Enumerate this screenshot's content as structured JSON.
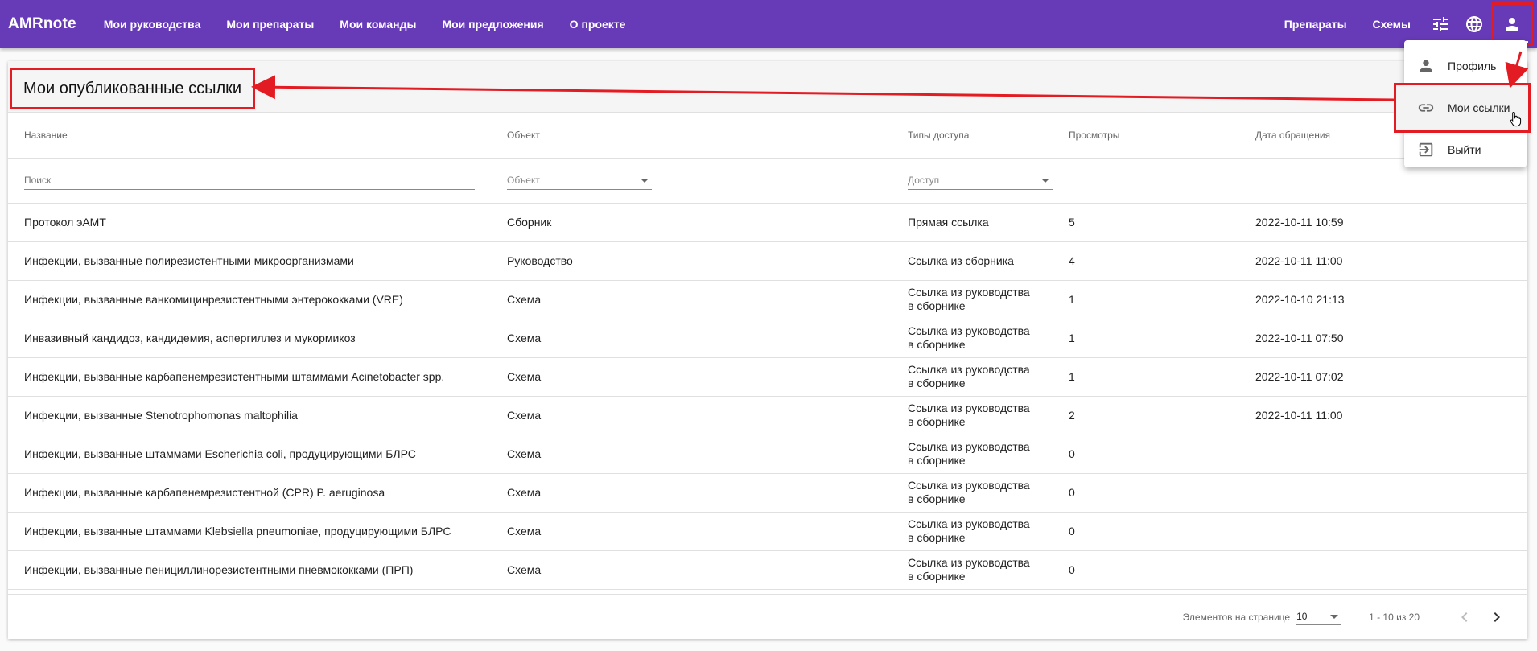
{
  "header": {
    "brand": "AMRnote",
    "nav": [
      {
        "label": "Мои руководства"
      },
      {
        "label": "Мои препараты"
      },
      {
        "label": "Мои команды"
      },
      {
        "label": "Мои предложения"
      },
      {
        "label": "О проекте"
      }
    ],
    "right_links": [
      {
        "label": "Препараты"
      },
      {
        "label": "Схемы"
      }
    ],
    "icons": [
      "tune-icon",
      "globe-icon",
      "user-icon"
    ]
  },
  "page": {
    "title": "Мои опубликованные ссылки"
  },
  "table": {
    "columns": [
      "Название",
      "Объект",
      "Типы доступа",
      "Просмотры",
      "Дата обращения"
    ],
    "filters": {
      "search_placeholder": "Поиск",
      "object_placeholder": "Объект",
      "access_placeholder": "Доступ"
    },
    "rows": [
      {
        "name": "Протокол эАМТ",
        "object": "Сборник",
        "access": "Прямая ссылка",
        "views": "5",
        "date": "2022-10-11 10:59"
      },
      {
        "name": "Инфекции, вызванные полирезистентными микроорганизмами",
        "object": "Руководство",
        "access": "Ссылка из сборника",
        "views": "4",
        "date": "2022-10-11 11:00"
      },
      {
        "name": "Инфекции, вызванные ванкомицинрезистентными энтерококками (VRE)",
        "object": "Схема",
        "access": "Ссылка из руководства в сборнике",
        "views": "1",
        "date": "2022-10-10 21:13"
      },
      {
        "name": "Инвазивный кандидоз, кандидемия, аспергиллез и мукормикоз",
        "object": "Схема",
        "access": "Ссылка из руководства в сборнике",
        "views": "1",
        "date": "2022-10-11 07:50"
      },
      {
        "name": "Инфекции, вызванные карбапенемрезистентными штаммами Acinetobacter spp.",
        "object": "Схема",
        "access": "Ссылка из руководства в сборнике",
        "views": "1",
        "date": "2022-10-11 07:02"
      },
      {
        "name": "Инфекции, вызванные Stenotrophomonas maltophilia",
        "object": "Схема",
        "access": "Ссылка из руководства в сборнике",
        "views": "2",
        "date": "2022-10-11 11:00"
      },
      {
        "name": "Инфекции, вызванные штаммами Escherichia coli, продуцирующими БЛРС",
        "object": "Схема",
        "access": "Ссылка из руководства в сборнике",
        "views": "0",
        "date": ""
      },
      {
        "name": "Инфекции, вызванные карбапенемрезистентной (CPR) P. aeruginosa",
        "object": "Схема",
        "access": "Ссылка из руководства в сборнике",
        "views": "0",
        "date": ""
      },
      {
        "name": "Инфекции, вызванные штаммами Klebsiella pneumoniae, продуцирующими БЛРС",
        "object": "Схема",
        "access": "Ссылка из руководства в сборнике",
        "views": "0",
        "date": ""
      },
      {
        "name": "Инфекции, вызванные пенициллинорезистентными пневмококками (ПРП)",
        "object": "Схема",
        "access": "Ссылка из руководства в сборнике",
        "views": "0",
        "date": ""
      }
    ]
  },
  "paginator": {
    "label": "Элементов на странице",
    "page_size": "10",
    "range": "1 - 10 из 20"
  },
  "user_menu": {
    "items": [
      {
        "label": "Профиль",
        "icon": "person-icon"
      },
      {
        "label": "Мои ссылки",
        "icon": "link-icon"
      },
      {
        "label": "Выйти",
        "icon": "logout-icon"
      }
    ]
  },
  "colors": {
    "primary": "#673ab7",
    "annotation": "#e31b23"
  }
}
